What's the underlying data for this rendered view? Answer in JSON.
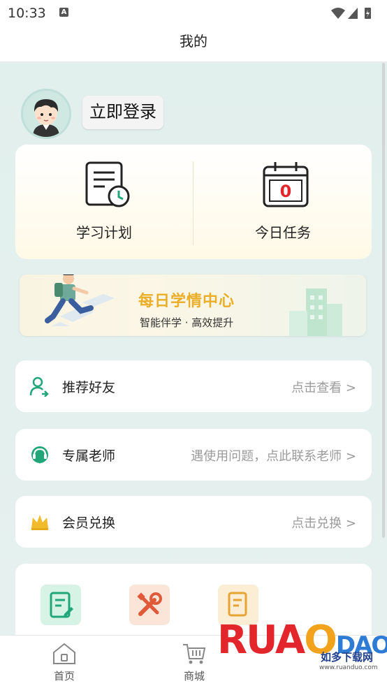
{
  "status_bar": {
    "time": "10:33",
    "notif_icon": "a-icon"
  },
  "header": {
    "title": "我的"
  },
  "profile": {
    "login_label": "立即登录"
  },
  "plan_card": {
    "study_plan_label": "学习计划",
    "today_task_label": "今日任务",
    "today_task_count": "0"
  },
  "banner": {
    "title": "每日学情中心",
    "subtitle": "智能伴学 · 高效提升"
  },
  "rows": [
    {
      "label": "推荐好友",
      "hint": "点击查看 >"
    },
    {
      "label": "专属老师",
      "hint": "遇使用问题，点此联系老师 >"
    },
    {
      "label": "会员兑换",
      "hint": "点击兑换 >"
    }
  ],
  "tabs": [
    {
      "label": "首页"
    },
    {
      "label": "商城"
    }
  ],
  "watermark": {
    "brand": "RUANDUO",
    "cn": "如多下载网",
    "url": "www.ruanduo.com"
  },
  "colors": {
    "accent_green": "#21a67a",
    "gold": "#eaae28",
    "red": "#e2262b"
  }
}
